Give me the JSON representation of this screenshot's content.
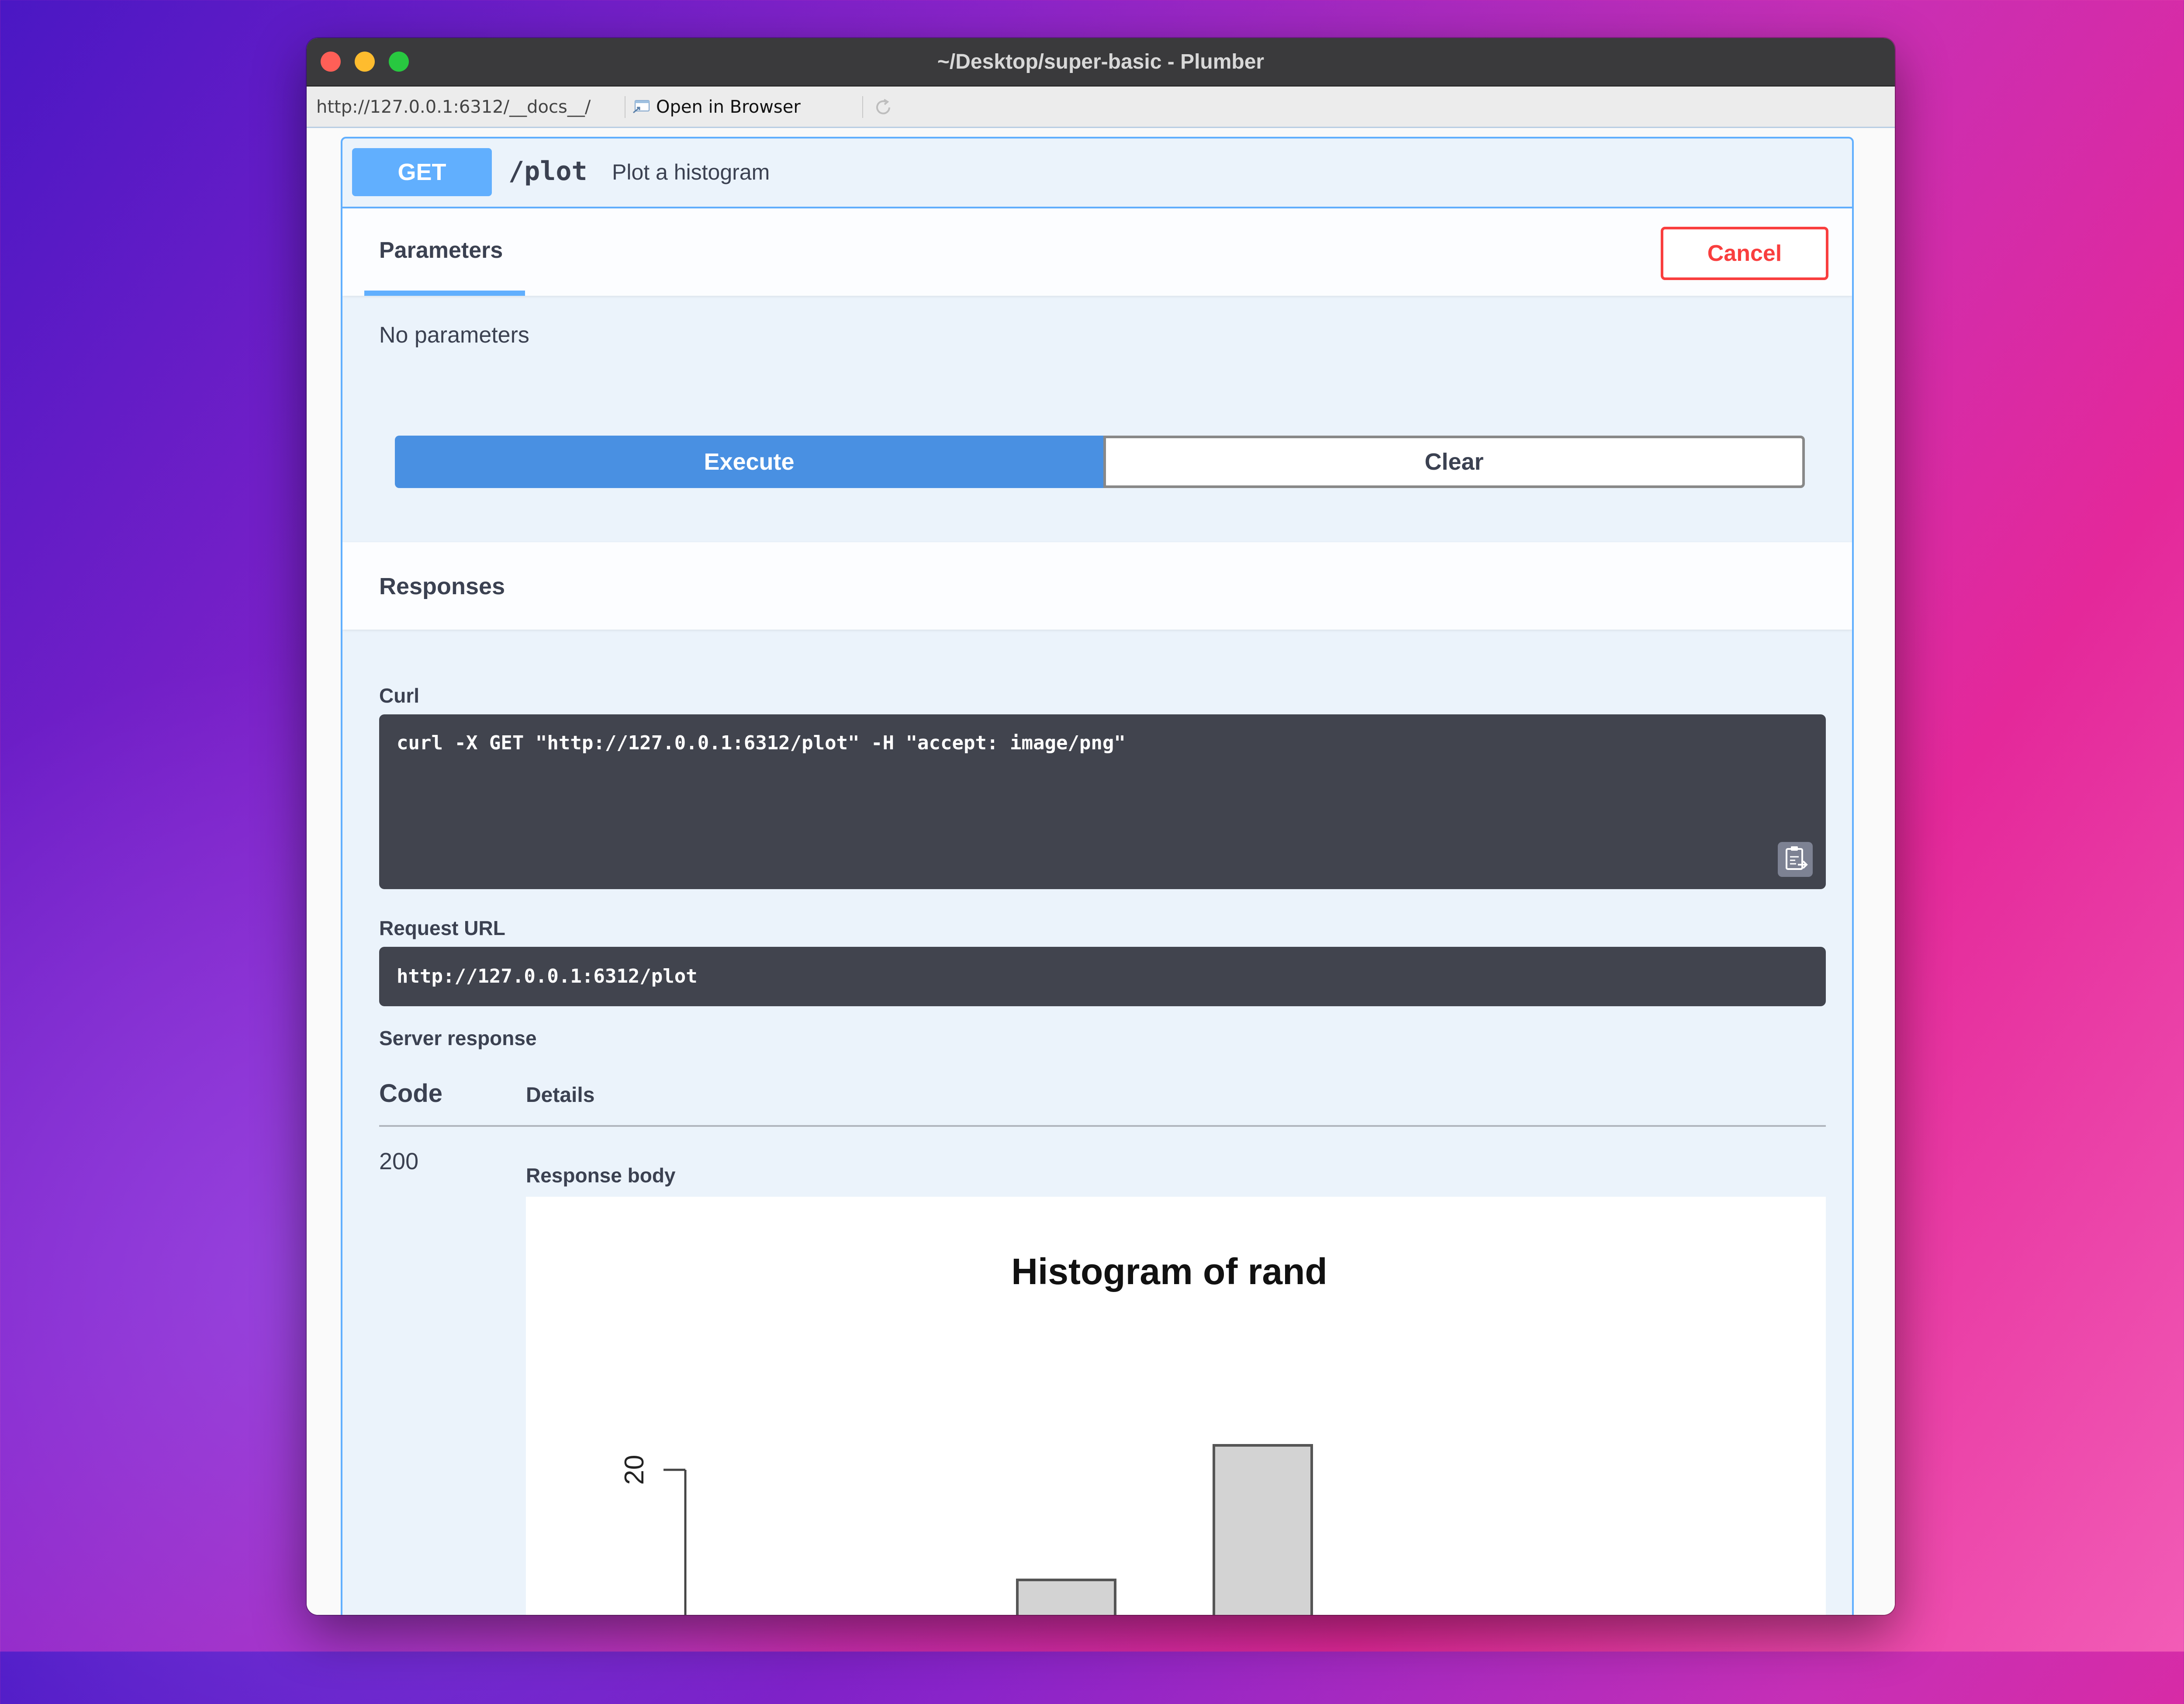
{
  "window": {
    "title": "~/Desktop/super-basic - Plumber"
  },
  "toolbar": {
    "url": "http://127.0.0.1:6312/__docs__/",
    "open_in_browser_label": "Open in Browser",
    "browser_icon": "browser-window-icon",
    "refresh_icon": "refresh-icon"
  },
  "operation": {
    "method": "GET",
    "path": "/plot",
    "summary": "Plot a histogram",
    "method_color": "#61affe"
  },
  "parameters": {
    "tab_label": "Parameters",
    "cancel_label": "Cancel",
    "empty_text": "No parameters",
    "execute_label": "Execute",
    "clear_label": "Clear"
  },
  "responses": {
    "title": "Responses",
    "curl_label": "Curl",
    "curl_command": "curl -X GET \"http://127.0.0.1:6312/plot\" -H \"accept: image/png\"",
    "copy_icon": "clipboard-copy-icon",
    "request_url_label": "Request URL",
    "request_url": "http://127.0.0.1:6312/plot",
    "server_response_label": "Server response",
    "col_code": "Code",
    "col_details": "Details",
    "code": "200",
    "response_body_label": "Response body"
  },
  "chart_data": {
    "type": "bar",
    "title": "Histogram of rand",
    "xlabel": "",
    "ylabel": "",
    "y_ticks": [
      "20"
    ],
    "y_tick_values": [
      20
    ],
    "ylim_visible": [
      10,
      23
    ],
    "bars_visible": [
      {
        "index": 1,
        "value": 11
      },
      {
        "index": 2,
        "value": 22
      }
    ],
    "fill_color": "#d3d3d3",
    "stroke_color": "#555555"
  }
}
